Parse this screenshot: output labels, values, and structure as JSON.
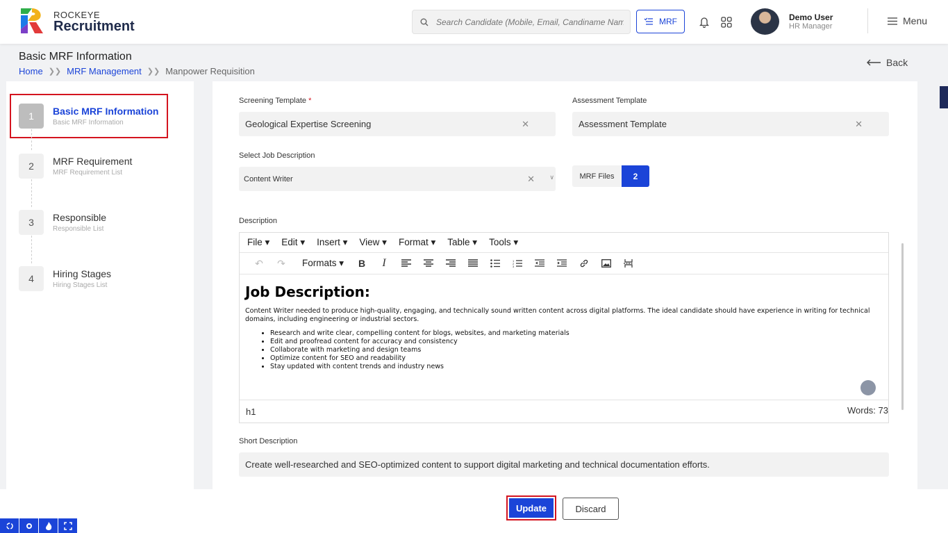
{
  "brand": {
    "top": "ROCKEYE",
    "main": "Recruitment"
  },
  "header": {
    "search_placeholder": "Search Candidate (Mobile, Email, Candiname Name)",
    "mrf_label": "MRF",
    "user_name": "Demo User",
    "user_role": "HR Manager",
    "menu_label": "Menu"
  },
  "page": {
    "title": "Basic MRF Information",
    "breadcrumbs": [
      "Home",
      "MRF Management",
      "Manpower Requisition"
    ],
    "back_label": "Back"
  },
  "steps": [
    {
      "num": "1",
      "title": "Basic MRF Information",
      "subtitle": "Basic MRF Information"
    },
    {
      "num": "2",
      "title": "MRF Requirement",
      "subtitle": "MRF Requirement List"
    },
    {
      "num": "3",
      "title": "Responsible",
      "subtitle": "Responsible List"
    },
    {
      "num": "4",
      "title": "Hiring Stages",
      "subtitle": "Hiring Stages List"
    }
  ],
  "form": {
    "screening_label": "Screening Template",
    "screening_required": "*",
    "screening_value": "Geological Expertise Screening",
    "assessment_label": "Assessment Template",
    "assessment_value": "Assessment Template",
    "job_desc_label": "Select Job Description",
    "job_desc_value": "Content Writer",
    "files_label": "MRF Files",
    "files_count": "2",
    "description_label": "Description",
    "short_desc_label": "Short Description",
    "short_desc_value": "Create well-researched and SEO-optimized content to support digital marketing and technical documentation efforts."
  },
  "editor": {
    "menus": [
      "File",
      "Edit",
      "Insert",
      "View",
      "Format",
      "Table",
      "Tools"
    ],
    "formats_label": "Formats",
    "heading": "Job Description:",
    "paragraph": "Content Writer needed to produce high-quality, engaging, and technically sound written content across digital platforms. The ideal candidate should have experience in writing for technical domains, including engineering or industrial sectors.",
    "bullets": [
      "Research and write clear, compelling content for blogs, websites, and marketing materials",
      "Edit and proofread content for accuracy and consistency",
      "Collaborate with marketing and design teams",
      "Optimize content for SEO and readability",
      "Stay updated with content trends and industry news"
    ],
    "path": "h1",
    "word_count": "Words: 73"
  },
  "footer": {
    "update_label": "Update",
    "discard_label": "Discard"
  },
  "colors": {
    "accent": "#1b44d8",
    "highlight": "#d4141f"
  }
}
